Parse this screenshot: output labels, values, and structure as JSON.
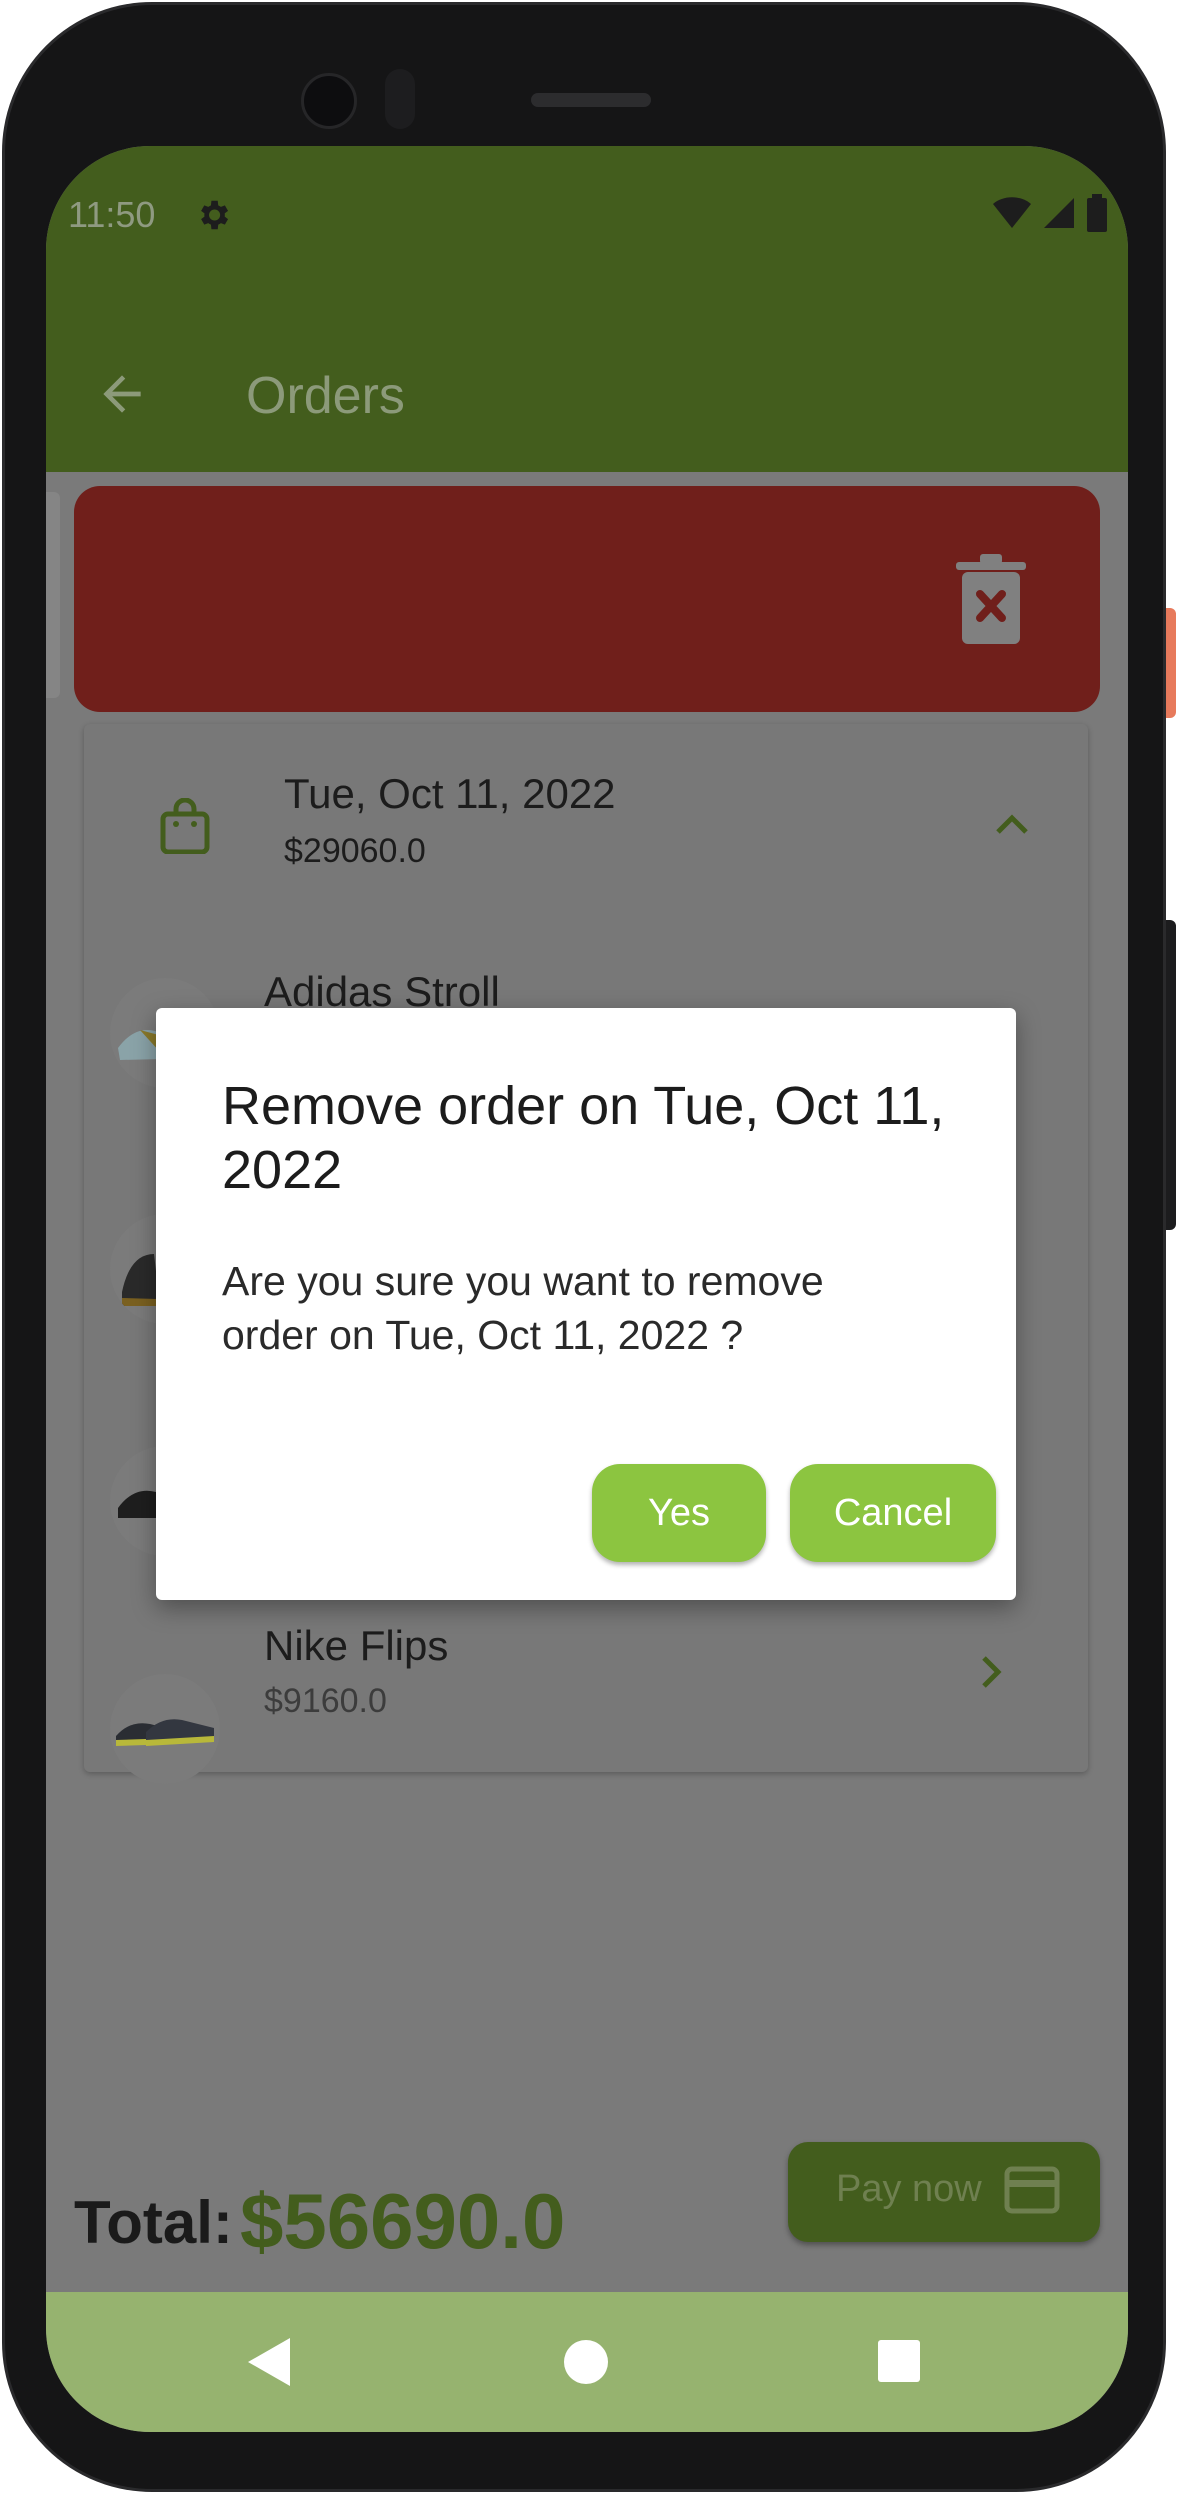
{
  "status_bar": {
    "time": "11:50"
  },
  "app_bar": {
    "title": "Orders"
  },
  "order": {
    "date": "Tue, Oct 11, 2022",
    "total": "$29060.0",
    "items": [
      {
        "name": "Adidas Stroll",
        "price": ""
      },
      {
        "name": "Nike Flips",
        "price": "$9160.0"
      }
    ]
  },
  "footer": {
    "total_label": "Total:",
    "total_value": "$56690.0",
    "pay_button": "Pay now"
  },
  "dialog": {
    "title": "Remove order on Tue, Oct 11, 2022",
    "message": "Are you sure you want to remove order on Tue, Oct 11, 2022 ?",
    "yes_label": "Yes",
    "cancel_label": "Cancel"
  },
  "colors": {
    "app_bar": "#435d1d",
    "delete_background": "#701f1b",
    "accent_button": "#8cc540",
    "nav_bar": "#96b36f"
  }
}
